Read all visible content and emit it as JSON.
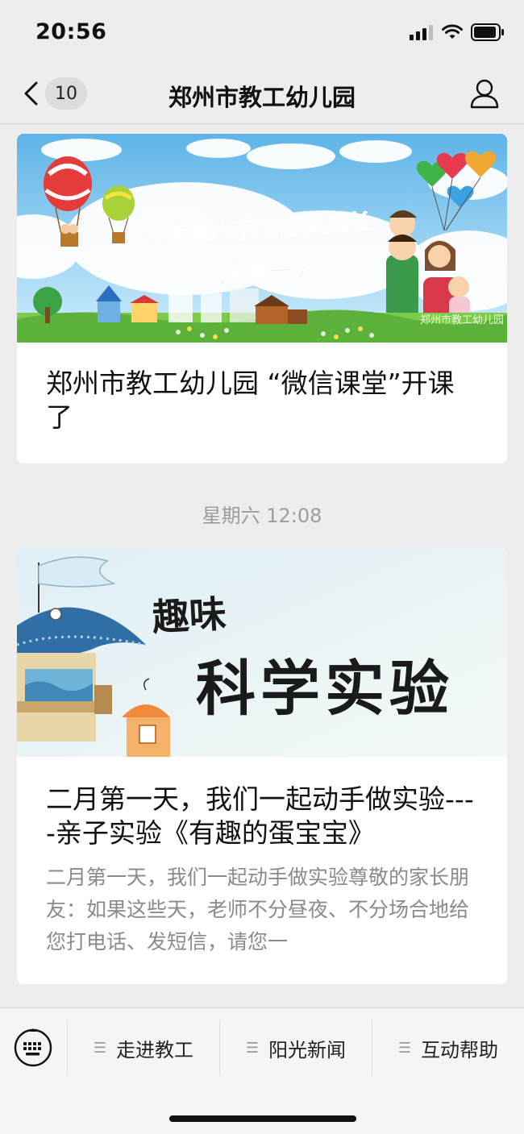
{
  "status_bar": {
    "time": "20:56",
    "signal_icon": "signal-bars-icon",
    "wifi_icon": "wifi-icon",
    "battery_icon": "battery-icon"
  },
  "nav": {
    "back_icon": "chevron-left-icon",
    "unread_count": "10",
    "title": "郑州市教工幼儿园",
    "profile_icon": "person-icon"
  },
  "messages": [
    {
      "cover": {
        "banner_line1": "大手拿小手 你我共成长",
        "banner_line2": "快乐每一天",
        "watermark": "郑州市教工幼儿园"
      },
      "title": "郑州市教工幼儿园 “微信课堂”开课了"
    },
    {
      "timestamp": "星期六 12:08",
      "cover": {
        "line1": "趣味",
        "line2": "科学实验"
      },
      "title": "二月第一天，我们一起动手做实验----亲子实验《有趣的蛋宝宝》",
      "digest": "二月第一天，我们一起动手做实验尊敬的家长朋友：如果这些天，老师不分昼夜、不分场合地给您打电话、发短信，请您一"
    }
  ],
  "bottom_menu": {
    "keyboard_icon": "keyboard-icon",
    "items": [
      {
        "label": "走进教工",
        "icon": "menu-lines-icon"
      },
      {
        "label": "阳光新闻",
        "icon": "menu-lines-icon"
      },
      {
        "label": "互动帮助",
        "icon": "menu-lines-icon"
      }
    ]
  },
  "colors": {
    "background": "#ededed",
    "card": "#ffffff",
    "title_text": "#111111",
    "digest_text": "#8a8a8a",
    "timestamp_text": "#9c9c9c"
  }
}
